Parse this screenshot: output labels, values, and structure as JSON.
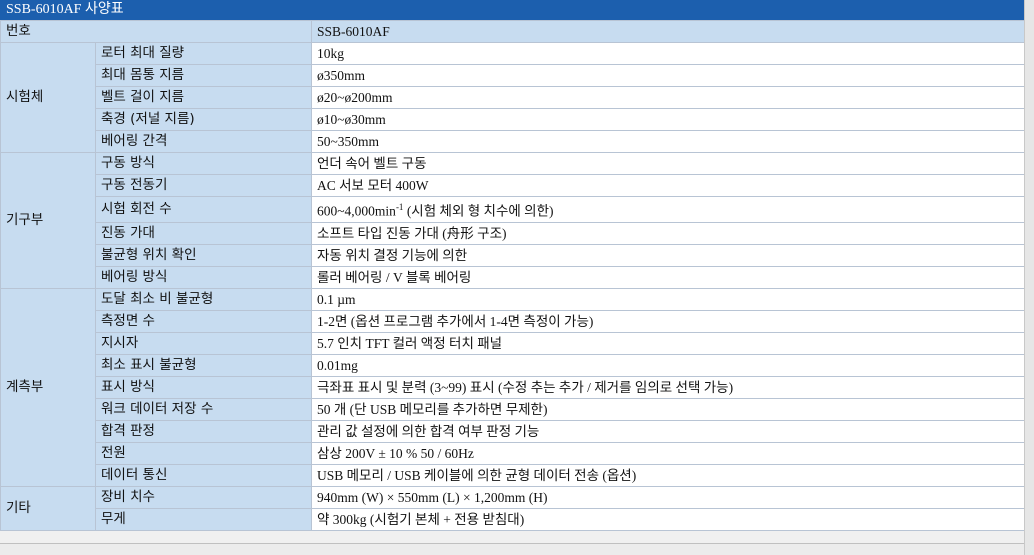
{
  "title": "SSB-6010AF 사양표",
  "header": {
    "label": "번호",
    "value": "SSB-6010AF"
  },
  "groups": [
    {
      "category": "시험체",
      "rows": [
        {
          "item": "로터 최대 질량",
          "value": "10kg"
        },
        {
          "item": "최대 몸통 지름",
          "value": "ø350mm"
        },
        {
          "item": "벨트 걸이 지름",
          "value": "ø20~ø200mm"
        },
        {
          "item": "축경 (저널 지름)",
          "value": "ø10~ø30mm"
        },
        {
          "item": "베어링 간격",
          "value": "50~350mm"
        }
      ]
    },
    {
      "category": "기구부",
      "rows": [
        {
          "item": "구동 방식",
          "value": "언더 속어 벨트 구동"
        },
        {
          "item": "구동 전동기",
          "value": "AC 서보 모터 400W"
        },
        {
          "item": "시험 회전 수",
          "value": "600~4,000min",
          "sup": "-1",
          "value_suffix": " (시험 체외 형 치수에 의한)"
        },
        {
          "item": "진동 가대",
          "value": "소프트 타입 진동 가대 (舟形 구조)"
        },
        {
          "item": "불균형 위치 확인",
          "value": "자동 위치 결정 기능에 의한"
        },
        {
          "item": "베어링 방식",
          "value": "롤러 베어링 / V 블록 베어링"
        }
      ]
    },
    {
      "category": "계측부",
      "rows": [
        {
          "item": "도달 최소 비 불균형",
          "value": "0.1 µm"
        },
        {
          "item": "측정면 수",
          "value": "1-2면 (옵션 프로그램 추가에서 1-4면 측정이 가능)"
        },
        {
          "item": "지시자",
          "value": "5.7 인치 TFT 컬러 액정 터치 패널"
        },
        {
          "item": "최소 표시 불균형",
          "value": "0.01mg"
        },
        {
          "item": "표시 방식",
          "value": "극좌표 표시 및 분력 (3~99) 표시 (수정 추는 추가 / 제거를 임의로 선택 가능)"
        },
        {
          "item": "워크 데이터 저장 수",
          "value": "50 개 (단 USB 메모리를 추가하면 무제한)"
        },
        {
          "item": "합격 판정",
          "value": "관리 값 설정에 의한 합격 여부 판정 기능"
        },
        {
          "item": "전원",
          "value": "삼상 200V ± 10 % 50 / 60Hz"
        },
        {
          "item": "데이터 통신",
          "value": "USB 메모리 / USB 케이블에 의한 균형 데이터 전송 (옵션)"
        }
      ]
    },
    {
      "category": "기타",
      "rows": [
        {
          "item": "장비 치수",
          "value": "940mm (W) × 550mm (L) × 1,200mm (H)"
        },
        {
          "item": "무게",
          "value": "약 300kg (시험기 본체 + 전용 받침대)"
        }
      ]
    }
  ],
  "colors": {
    "title_bg": "#1c5fae",
    "label_bg": "#c7dcf0",
    "value_bg": "#ffffff",
    "border": "#b8c4d4"
  }
}
